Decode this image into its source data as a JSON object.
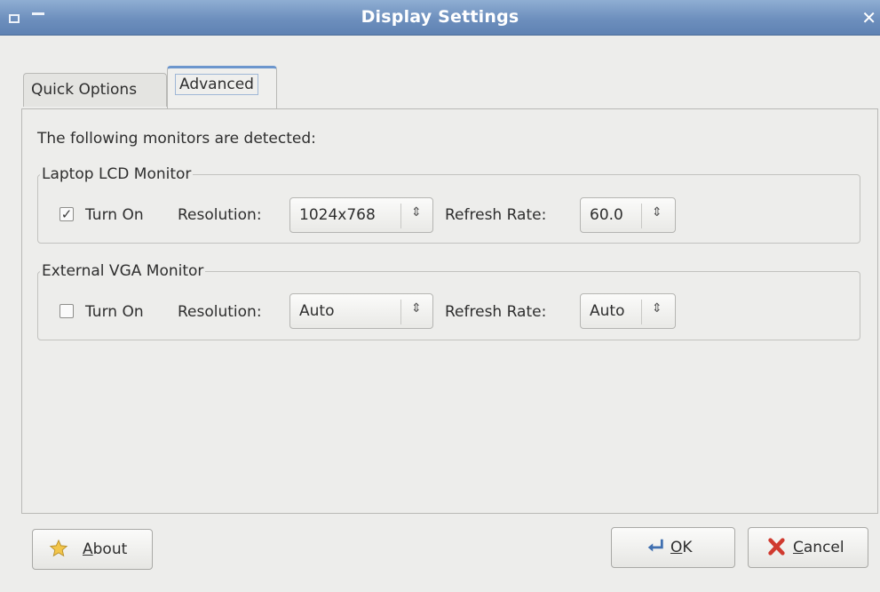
{
  "window": {
    "title": "Display Settings",
    "close_glyph": "✕"
  },
  "tabs": [
    {
      "label": "Quick Options",
      "active": false
    },
    {
      "label": "Advanced",
      "active": true
    }
  ],
  "detected_text": "The following monitors are detected:",
  "monitors": [
    {
      "name": "Laptop LCD Monitor",
      "turn_on_label": "Turn On",
      "turned_on": true,
      "check_glyph": "✓",
      "resolution_label": "Resolution:",
      "resolution_value": "1024x768",
      "refresh_label": "Refresh Rate:",
      "refresh_value": "60.0"
    },
    {
      "name": "External VGA Monitor",
      "turn_on_label": "Turn On",
      "turned_on": false,
      "check_glyph": "",
      "resolution_label": "Resolution:",
      "resolution_value": "Auto",
      "refresh_label": "Refresh Rate:",
      "refresh_value": "Auto"
    }
  ],
  "buttons": {
    "about": {
      "mnemonic": "A",
      "rest": "bout",
      "icon": "star-icon"
    },
    "ok": {
      "mnemonic": "O",
      "rest": "K",
      "icon": "enter-arrow-icon"
    },
    "cancel": {
      "mnemonic": "C",
      "rest": "ancel",
      "icon": "red-x-icon"
    }
  },
  "icons": {
    "window_menu": "window-menu-icon",
    "minimize": "minimize-icon",
    "close": "close-icon",
    "spinner": "spin-arrows-icon"
  },
  "colors": {
    "titlebar": "#6d8fbd",
    "tab_accent": "#6c96cd",
    "cancel_icon": "#d03a2f",
    "star_icon": "#f2c54a"
  }
}
